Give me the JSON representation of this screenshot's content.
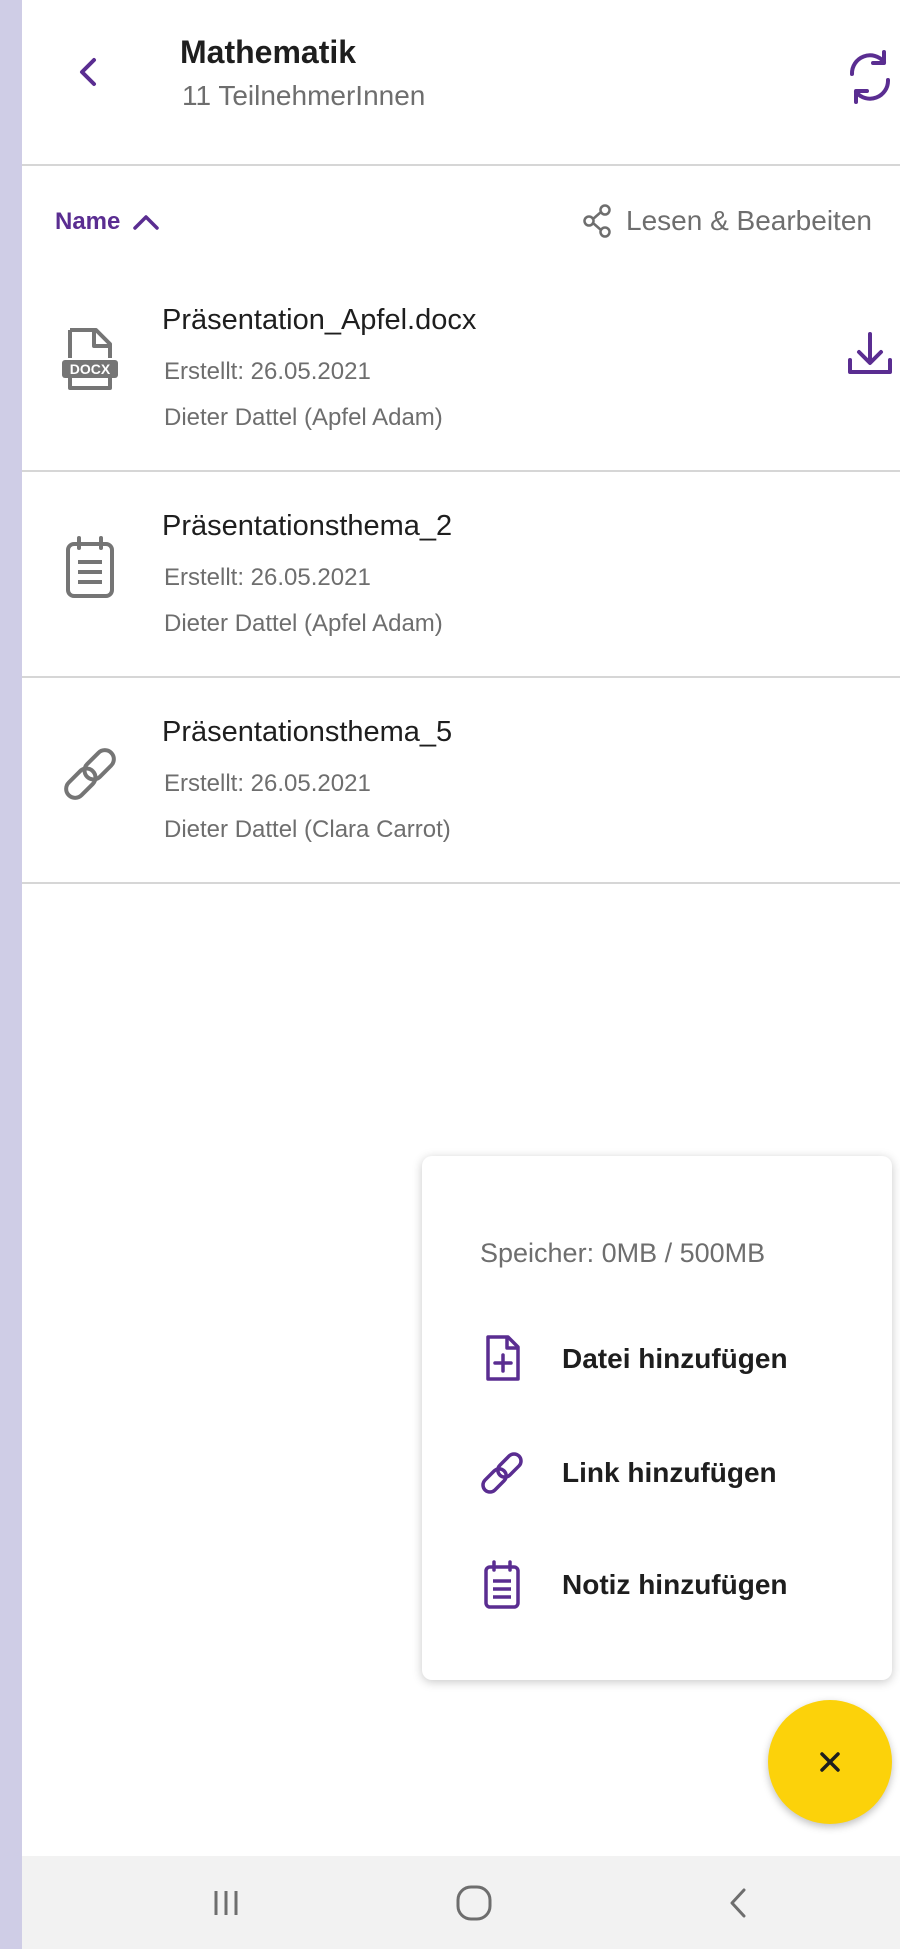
{
  "header": {
    "title": "Mathematik",
    "subtitle": "11 TeilnehmerInnen"
  },
  "sort": {
    "label": "Name",
    "permission": "Lesen & Bearbeiten"
  },
  "files": [
    {
      "name": "Präsentation_Apfel.docx",
      "created": "Erstellt: 26.05.2021",
      "author": "Dieter Dattel (Apfel Adam)",
      "icon": "docx-file-icon"
    },
    {
      "name": "Präsentationsthema_2",
      "created": "Erstellt: 26.05.2021",
      "author": "Dieter Dattel (Apfel Adam)",
      "icon": "note-icon"
    },
    {
      "name": "Präsentationsthema_5",
      "created": "Erstellt: 26.05.2021",
      "author": "Dieter Dattel (Clara  Carrot)",
      "icon": "link-icon"
    }
  ],
  "menu": {
    "storage": "Speicher: 0MB / 500MB",
    "add_file": "Datei hinzufügen",
    "add_link": "Link hinzufügen",
    "add_note": "Notiz hinzufügen"
  },
  "fab": {
    "label": "×"
  },
  "colors": {
    "accent": "#5a2d91",
    "fab": "#fcd20a",
    "text": "#1e1e1e",
    "secondary_text": "#6e6e6e"
  }
}
